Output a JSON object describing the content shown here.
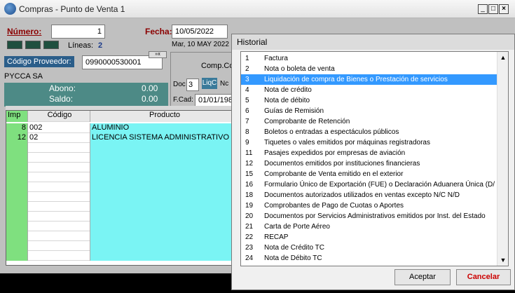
{
  "window": {
    "title": "Compras - Punto de Venta 1"
  },
  "header": {
    "numero_label": "Número:",
    "numero_value": "1",
    "fecha_label": "Fecha:",
    "fecha_value": "10/05/2022",
    "fecha_long": "Mar, 10 MAY 2022",
    "lineas_label": "Líneas:",
    "lineas_value": "2",
    "proveedor_label": "Código Proveedor:",
    "proveedor_value": "0990000530001",
    "proveedor_name": "PYCCA SA",
    "abono_label": "Abono:",
    "abono_value": "0.00",
    "saldo_label": "Saldo:",
    "saldo_value": "0.00",
    "comp_label": "Comp.Co",
    "doc_label": "Doc",
    "doc_value": "3",
    "doc_type": "LiqC",
    "doc_after": "Nc",
    "fcad_label": "F.Cad:",
    "fcad_value": "01/01/198"
  },
  "grid": {
    "headers": [
      "Imp",
      "Código",
      "Producto"
    ],
    "rows": [
      {
        "imp": "8",
        "codigo": "002",
        "producto": "ALUMINIO"
      },
      {
        "imp": "12",
        "codigo": "02",
        "producto": "LICENCIA SISTEMA ADMINISTRATIVO - CO"
      }
    ]
  },
  "historial": {
    "title": "Historial",
    "items": [
      {
        "num": "1",
        "label": "Factura"
      },
      {
        "num": "2",
        "label": "Nota o boleta de venta"
      },
      {
        "num": "3",
        "label": "Liquidación de compra de Bienes o Prestación de servicios"
      },
      {
        "num": "4",
        "label": "Nota de crédito"
      },
      {
        "num": "5",
        "label": "Nota de débito"
      },
      {
        "num": "6",
        "label": "Guías de Remisión"
      },
      {
        "num": "7",
        "label": "Comprobante de Retención"
      },
      {
        "num": "8",
        "label": "Boletos o entradas a espectáculos públicos"
      },
      {
        "num": "9",
        "label": "Tiquetes o vales emitidos por máquinas registradoras"
      },
      {
        "num": "11",
        "label": "Pasajes expedidos por empresas de aviación"
      },
      {
        "num": "12",
        "label": "Documentos emitidos por instituciones financieras"
      },
      {
        "num": "15",
        "label": "Comprobante de Venta emitido en el exterior"
      },
      {
        "num": "16",
        "label": "Formulario Único de Exportación (FUE) o Declaración Aduanera Única (D/"
      },
      {
        "num": "18",
        "label": "Documentos autorizados utilizados en ventas excepto N/C N/D"
      },
      {
        "num": "19",
        "label": "Comprobantes de Pago de Cuotas o Aportes"
      },
      {
        "num": "20",
        "label": "Documentos por Servicios Administrativos emitidos por Inst. del Estado"
      },
      {
        "num": "21",
        "label": "Carta de Porte Aéreo"
      },
      {
        "num": "22",
        "label": "RECAP"
      },
      {
        "num": "23",
        "label": "Nota de Crédito TC"
      },
      {
        "num": "24",
        "label": "Nota de Débito TC"
      }
    ],
    "selected_index": 2,
    "accept_label": "Aceptar",
    "cancel_label": "Cancelar"
  },
  "colors": {
    "selection": "#3399ff",
    "imp_column": "#7fe07f",
    "producto_column": "#7af4f4",
    "cancel_text": "#cc0000",
    "label_red": "#8b0000"
  }
}
